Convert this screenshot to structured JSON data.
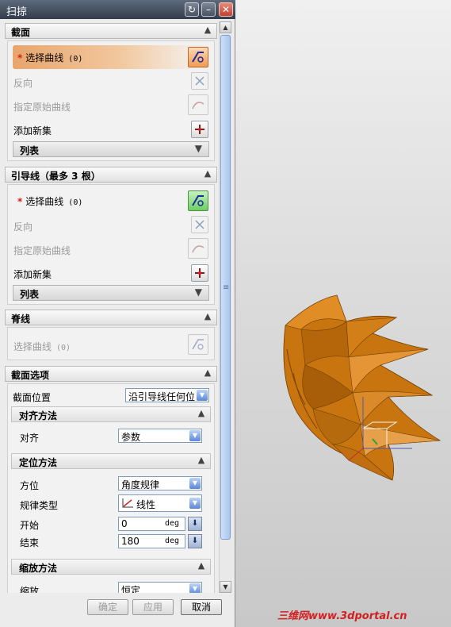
{
  "window": {
    "title": "扫掠"
  },
  "section_profile": {
    "title": "截面",
    "select_curve": {
      "label": "选择曲线",
      "count": "(0)"
    },
    "reverse": "反向",
    "origin_curve": "指定原始曲线",
    "add_new_set": "添加新集",
    "list": "列表"
  },
  "section_guide": {
    "title": "引导线（最多 3 根）",
    "select_curve": {
      "label": "选择曲线",
      "count": "(0)"
    },
    "reverse": "反向",
    "origin_curve": "指定原始曲线",
    "add_new_set": "添加新集",
    "list": "列表"
  },
  "section_spine": {
    "title": "脊线",
    "select_curve": {
      "label": "选择曲线",
      "count": "(0)"
    }
  },
  "section_options": {
    "title": "截面选项",
    "section_position_label": "截面位置",
    "section_position_value": "沿引导线任何位",
    "alignment": {
      "title": "对齐方法",
      "label": "对齐",
      "value": "参数"
    },
    "orientation": {
      "title": "定位方法",
      "direction_label": "方位",
      "direction_value": "角度规律",
      "law_type_label": "规律类型",
      "law_type_value": "线性",
      "start_label": "开始",
      "start_value": "0",
      "end_label": "结束",
      "end_value": "180",
      "unit": "deg"
    },
    "scaling": {
      "title": "缩放方法",
      "label": "缩放",
      "value": "恒定"
    }
  },
  "buttons": {
    "ok": "确定",
    "apply": "应用",
    "cancel": "取消"
  },
  "watermark": "三维网www.3dportal.cn",
  "colors": {
    "model": "#c9750f",
    "accent_orange": "#f29a53",
    "required_star": "#d0201a"
  }
}
